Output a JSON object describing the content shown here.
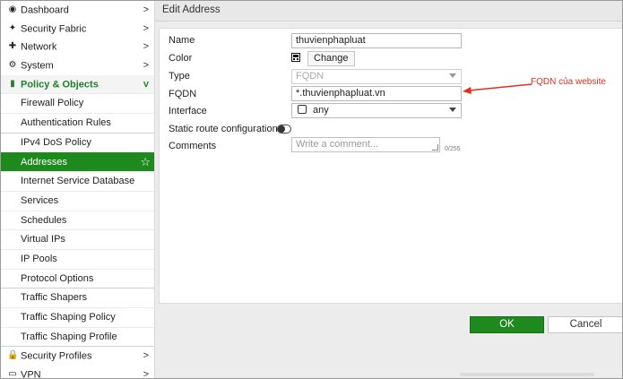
{
  "sidebar": {
    "items": [
      {
        "label": "Dashboard",
        "icon": "dashboard-icon",
        "chevron": ">"
      },
      {
        "label": "Security Fabric",
        "icon": "security-fabric-icon",
        "chevron": ">"
      },
      {
        "label": "Network",
        "icon": "network-icon",
        "chevron": ">"
      },
      {
        "label": "System",
        "icon": "gear-icon",
        "chevron": ">"
      },
      {
        "label": "Policy & Objects",
        "icon": "policy-icon",
        "chevron": "v"
      },
      {
        "label": "Firewall Policy"
      },
      {
        "label": "Authentication Rules"
      },
      {
        "label": "IPv4 DoS Policy"
      },
      {
        "label": "Addresses"
      },
      {
        "label": "Internet Service Database"
      },
      {
        "label": "Services"
      },
      {
        "label": "Schedules"
      },
      {
        "label": "Virtual IPs"
      },
      {
        "label": "IP Pools"
      },
      {
        "label": "Protocol Options"
      },
      {
        "label": "Traffic Shapers"
      },
      {
        "label": "Traffic Shaping Policy"
      },
      {
        "label": "Traffic Shaping Profile"
      },
      {
        "label": "Security Profiles",
        "icon": "lock-icon",
        "chevron": ">"
      },
      {
        "label": "VPN",
        "icon": "laptop-icon",
        "chevron": ">"
      }
    ]
  },
  "main": {
    "title": "Edit Address",
    "form": {
      "name_label": "Name",
      "name_value": "thuvienphapluat",
      "color_label": "Color",
      "change_label": "Change",
      "type_label": "Type",
      "type_value": "FQDN",
      "fqdn_label": "FQDN",
      "fqdn_value": "*.thuvienphapluat.vn",
      "interface_label": "Interface",
      "interface_value": "any",
      "static_route_label": "Static route configuration",
      "static_route_enabled": false,
      "comments_label": "Comments",
      "comments_placeholder": "Write a comment...",
      "comments_counter": "0/255"
    },
    "annotation": "FQDN của website",
    "ok_label": "OK",
    "cancel_label": "Cancel"
  },
  "colors": {
    "accent_green": "#1e8a1e",
    "group_text": "#1d7f2a",
    "annotation_red": "#e0301e"
  }
}
